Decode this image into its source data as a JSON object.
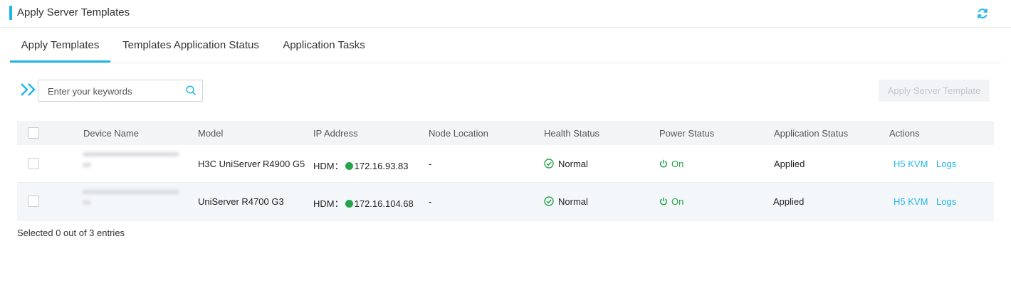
{
  "header": {
    "title": "Apply Server Templates",
    "refresh_icon": "refresh-icon"
  },
  "tabs": [
    {
      "label": "Apply Templates",
      "active": true
    },
    {
      "label": "Templates Application Status",
      "active": false
    },
    {
      "label": "Application Tasks",
      "active": false
    }
  ],
  "toolbar": {
    "search_placeholder": "Enter your keywords",
    "apply_button": "Apply Server Template"
  },
  "table": {
    "columns": [
      "Device Name",
      "Model",
      "IP Address",
      "Node Location",
      "Health Status",
      "Power Status",
      "Application Status",
      "Actions"
    ],
    "rows": [
      {
        "model": "H3C UniServer R4900 G5",
        "ip_prefix": "HDM：",
        "ip": "172.16.93.83",
        "node_location": "-",
        "health": "Normal",
        "power": "On",
        "application_status": "Applied",
        "action_kvm": "H5 KVM",
        "action_logs": "Logs"
      },
      {
        "model": "UniServer R4700 G3",
        "ip_prefix": "HDM：",
        "ip": "172.16.104.68",
        "node_location": "-",
        "health": "Normal",
        "power": "On",
        "application_status": "Applied",
        "action_kvm": "H5 KVM",
        "action_logs": "Logs"
      }
    ]
  },
  "footer": {
    "selection_text": "Selected 0 out of 3 entries"
  },
  "colors": {
    "accent": "#1fb6ea",
    "status_green": "#27a34b",
    "header_bg": "#f2f4f6"
  }
}
